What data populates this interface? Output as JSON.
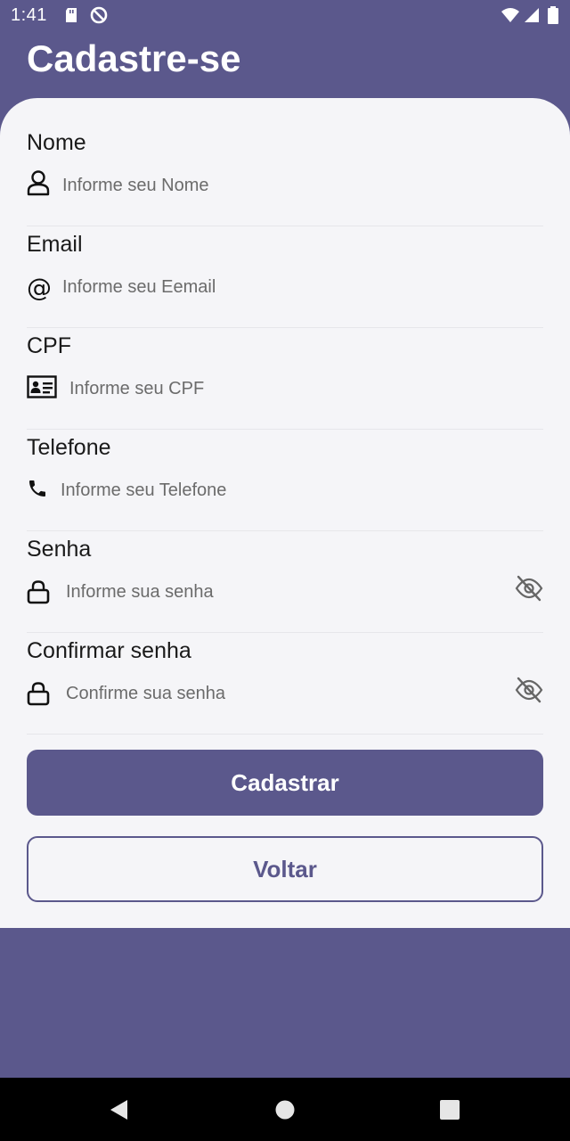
{
  "status_bar": {
    "time": "1:41"
  },
  "header": {
    "title": "Cadastre-se"
  },
  "form": {
    "fields": [
      {
        "label": "Nome",
        "placeholder": "Informe seu Nome",
        "icon": "user-icon"
      },
      {
        "label": "Email",
        "placeholder": "Informe seu Eemail",
        "icon": "at-icon"
      },
      {
        "label": "CPF",
        "placeholder": "Informe seu CPF",
        "icon": "id-card-icon"
      },
      {
        "label": "Telefone",
        "placeholder": "Informe seu Telefone",
        "icon": "phone-icon"
      },
      {
        "label": "Senha",
        "placeholder": "Informe sua senha",
        "icon": "lock-icon",
        "toggle_icon": "eye-off-icon"
      },
      {
        "label": "Confirmar senha",
        "placeholder": "Confirme sua senha",
        "icon": "lock-icon",
        "toggle_icon": "eye-off-icon"
      }
    ]
  },
  "actions": {
    "primary_label": "Cadastrar",
    "secondary_label": "Voltar"
  },
  "colors": {
    "primary": "#5b588c",
    "card_background": "#f5f5f8"
  }
}
